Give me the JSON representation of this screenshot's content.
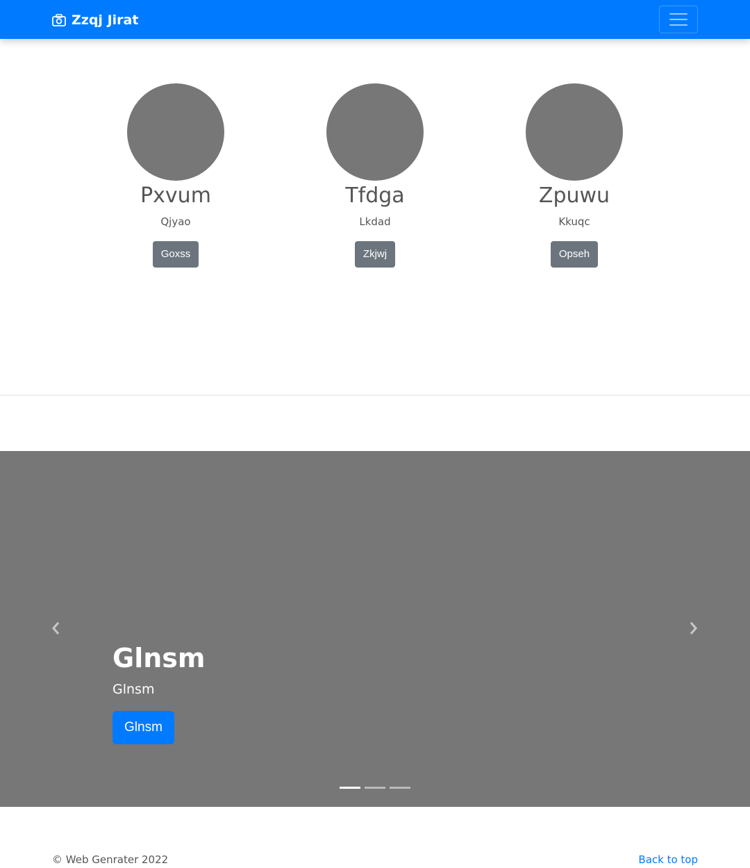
{
  "navbar": {
    "brand": "Zzqj Jirat",
    "brand_icon": "camera-icon",
    "toggler_icon": "hamburger-menu-icon",
    "color": "#007bff"
  },
  "team": [
    {
      "name": "Pxvum",
      "role": "Qjyao",
      "button": "Goxss"
    },
    {
      "name": "Tfdga",
      "role": "Lkdad",
      "button": "Zkjwj"
    },
    {
      "name": "Zpuwu",
      "role": "Kkuqc",
      "button": "Opseh"
    }
  ],
  "carousel": {
    "title": "Glnsm",
    "text": "Glnsm",
    "button": "Glnsm",
    "prev_icon": "chevron-left-icon",
    "next_icon": "chevron-right-icon",
    "slide_count": 3,
    "active_slide": 1
  },
  "footer": {
    "copyright": "© Web Genrater 2022",
    "back_to_top": "Back to top"
  }
}
